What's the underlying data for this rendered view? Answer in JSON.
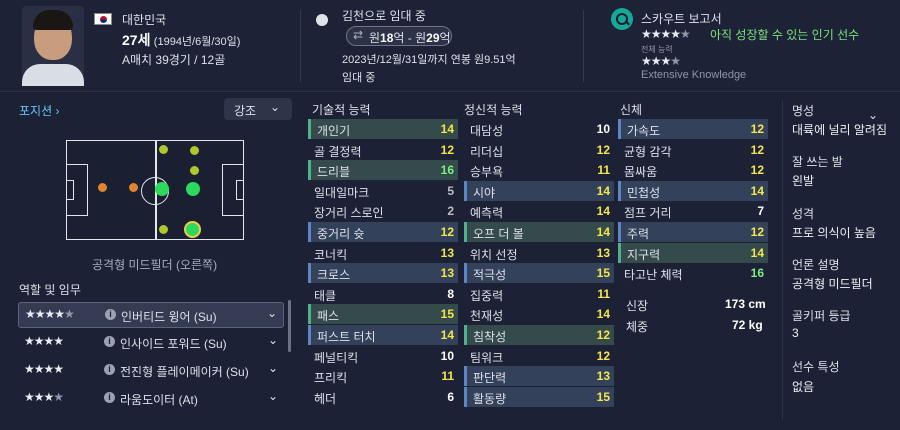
{
  "header": {
    "nationality": "대한민국",
    "age": "27세",
    "birth": "(1994년/6월/30일)",
    "matches": "A매치 39경기 / 12골",
    "loan_text": "김천으로 임대 중",
    "value_range_prefix": "원",
    "value_low": "18",
    "value_mid": "억 - 원",
    "value_high": "29",
    "value_suffix": "억",
    "contract": "2023년/12월/31일까지 연봉 원9.51억",
    "loan_status": "임대 중",
    "scout_title": "스카우트 보고서",
    "scout_potential_label": "아직 성장할 수 있는 인기 선수",
    "overall_label": "전체 능력",
    "knowledge": "Extensive Knowledge",
    "ability_stars": 3.5,
    "potential_stars": 4.5
  },
  "left": {
    "position_label": "포지션",
    "dropdown_label": "강조",
    "position_caption": "공격형 미드필더 (오른쪽)",
    "roles_title": "역할 및 임무",
    "roles": [
      {
        "name": "인버티드 윙어 (Su)",
        "stars": 4.5
      },
      {
        "name": "인사이드 포워드 (Su)",
        "stars": 4
      },
      {
        "name": "전진형 플레이메이커 (Su)",
        "stars": 4
      },
      {
        "name": "라움도이터 (At)",
        "stars": 3.5
      }
    ]
  },
  "technical": {
    "title": "기술적 능력",
    "items": [
      {
        "name": "개인기",
        "value": "14"
      },
      {
        "name": "골 결정력",
        "value": "12"
      },
      {
        "name": "드리블",
        "value": "16"
      },
      {
        "name": "일대일마크",
        "value": "5"
      },
      {
        "name": "장거리 스로인",
        "value": "2"
      },
      {
        "name": "중거리 슛",
        "value": "12"
      },
      {
        "name": "코너킥",
        "value": "13"
      },
      {
        "name": "크로스",
        "value": "13"
      },
      {
        "name": "태클",
        "value": "8"
      },
      {
        "name": "패스",
        "value": "15"
      },
      {
        "name": "퍼스트 터치",
        "value": "14"
      },
      {
        "name": "페널티킥",
        "value": "10"
      },
      {
        "name": "프리킥",
        "value": "11"
      },
      {
        "name": "헤더",
        "value": "6"
      }
    ]
  },
  "mental": {
    "title": "정신적 능력",
    "items": [
      {
        "name": "대담성",
        "value": "10"
      },
      {
        "name": "리더십",
        "value": "12"
      },
      {
        "name": "승부욕",
        "value": "11"
      },
      {
        "name": "시야",
        "value": "14"
      },
      {
        "name": "예측력",
        "value": "14"
      },
      {
        "name": "오프 더 볼",
        "value": "14"
      },
      {
        "name": "위치 선정",
        "value": "13"
      },
      {
        "name": "적극성",
        "value": "15"
      },
      {
        "name": "집중력",
        "value": "11"
      },
      {
        "name": "천재성",
        "value": "14"
      },
      {
        "name": "침착성",
        "value": "12"
      },
      {
        "name": "팀워크",
        "value": "12"
      },
      {
        "name": "판단력",
        "value": "13"
      },
      {
        "name": "활동량",
        "value": "15"
      }
    ]
  },
  "physical": {
    "title": "신체",
    "items": [
      {
        "name": "가속도",
        "value": "12"
      },
      {
        "name": "균형 감각",
        "value": "12"
      },
      {
        "name": "몸싸움",
        "value": "12"
      },
      {
        "name": "민첩성",
        "value": "14"
      },
      {
        "name": "점프 거리",
        "value": "7"
      },
      {
        "name": "주력",
        "value": "12"
      },
      {
        "name": "지구력",
        "value": "14"
      },
      {
        "name": "타고난 체력",
        "value": "16"
      }
    ],
    "height_label": "신장",
    "height": "173 cm",
    "weight_label": "체중",
    "weight": "72 kg"
  },
  "info": {
    "fame_label": "명성",
    "fame": "대륙에 널리 알려짐",
    "foot_label": "잘 쓰는 발",
    "foot": "왼발",
    "personality_label": "성격",
    "personality": "프로 의식이 높음",
    "media_label": "언론 설명",
    "media": "공격형 미드필더",
    "gk_label": "골키퍼 등급",
    "gk": "3",
    "traits_label": "선수 특성",
    "traits": "없음"
  }
}
